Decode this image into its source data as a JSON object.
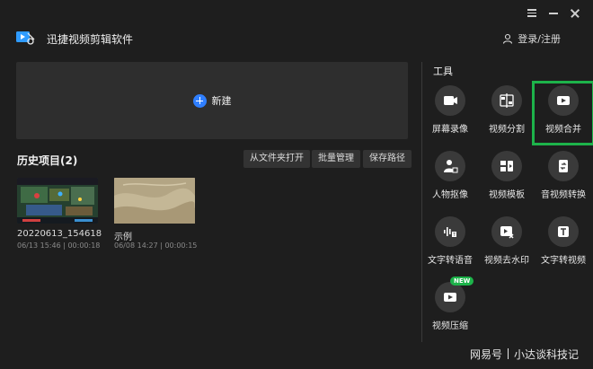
{
  "app": {
    "title": "迅捷视频剪辑软件",
    "login_label": "登录/注册"
  },
  "new_project": {
    "label": "新建"
  },
  "history": {
    "title": "历史项目(2)",
    "buttons": [
      "从文件夹打开",
      "批量管理",
      "保存路径"
    ],
    "projects": [
      {
        "name": "20220613_154618",
        "date": "06/13 15:46",
        "duration": "00:00:18"
      },
      {
        "name": "示例",
        "date": "06/08 14:27",
        "duration": "00:00:15"
      }
    ]
  },
  "tools": {
    "title": "工具",
    "items": [
      {
        "label": "屏幕录像",
        "icon": "screen-record-icon"
      },
      {
        "label": "视频分割",
        "icon": "video-split-icon"
      },
      {
        "label": "视频合并",
        "icon": "video-merge-icon",
        "selected": true
      },
      {
        "label": "人物抠像",
        "icon": "person-matting-icon"
      },
      {
        "label": "视频模板",
        "icon": "video-template-icon"
      },
      {
        "label": "音视频转换",
        "icon": "av-convert-icon"
      },
      {
        "label": "文字转语音",
        "icon": "text-to-speech-icon"
      },
      {
        "label": "视频去水印",
        "icon": "remove-watermark-icon"
      },
      {
        "label": "文字转视频",
        "icon": "text-to-video-icon"
      },
      {
        "label": "视频压缩",
        "icon": "video-compress-icon",
        "badge": "NEW"
      }
    ]
  },
  "watermark": {
    "left": "网易号",
    "right": "小达谈科技记"
  },
  "colors": {
    "accent": "#2f7fff",
    "selected_outline": "#1db34a",
    "background": "#1e1e1e",
    "panel": "#2e2e2e"
  }
}
